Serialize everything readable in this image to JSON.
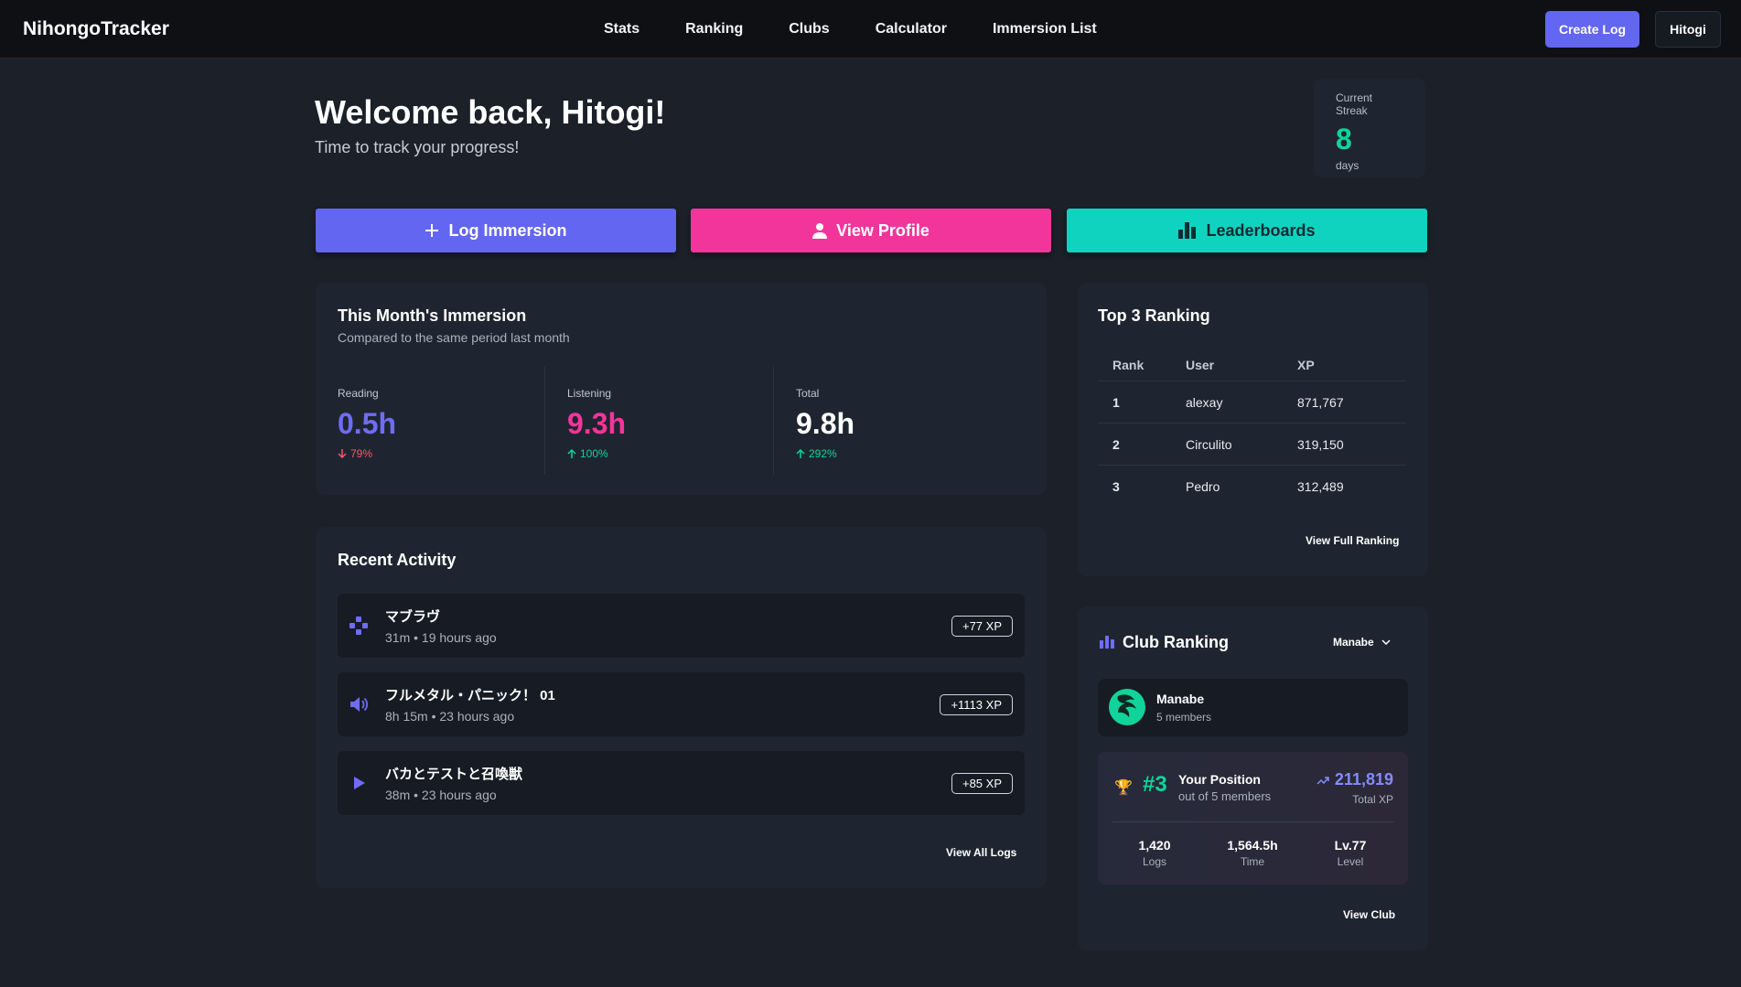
{
  "app": {
    "brand": "NihongoTracker"
  },
  "nav": {
    "items": [
      "Stats",
      "Ranking",
      "Clubs",
      "Calculator",
      "Immersion List"
    ]
  },
  "header": {
    "create_log": "Create Log",
    "user": "Hitogi"
  },
  "hero": {
    "title": "Welcome back, Hitogi!",
    "subtitle": "Time to track your progress!"
  },
  "streak": {
    "label": "Current Streak",
    "value": "8",
    "unit": "days"
  },
  "actions": {
    "log": "Log Immersion",
    "profile": "View Profile",
    "leaderboards": "Leaderboards"
  },
  "month": {
    "title": "This Month's Immersion",
    "subtitle": "Compared to the same period last month",
    "stats": [
      {
        "label": "Reading",
        "value": "0.5h",
        "change": "79%",
        "direction": "down"
      },
      {
        "label": "Listening",
        "value": "9.3h",
        "change": "100%",
        "direction": "up"
      },
      {
        "label": "Total",
        "value": "9.8h",
        "change": "292%",
        "direction": "up"
      }
    ]
  },
  "recent": {
    "title": "Recent Activity",
    "items": [
      {
        "icon": "gamepad-icon",
        "title": "マブラヴ",
        "meta": "31m • 19 hours ago",
        "xp": "+77 XP"
      },
      {
        "icon": "speaker-icon",
        "title": "フルメタル・パニック！ 01",
        "meta": "8h 15m • 23 hours ago",
        "xp": "+1113 XP"
      },
      {
        "icon": "play-icon",
        "title": "バカとテストと召喚獣",
        "meta": "38m • 23 hours ago",
        "xp": "+85 XP"
      }
    ],
    "view_all": "View All Logs"
  },
  "top3": {
    "title": "Top 3 Ranking",
    "headers": [
      "Rank",
      "User",
      "XP"
    ],
    "rows": [
      {
        "rank": "1",
        "user": "alexay",
        "xp": "871,767"
      },
      {
        "rank": "2",
        "user": "Circulito",
        "xp": "319,150"
      },
      {
        "rank": "3",
        "user": "Pedro",
        "xp": "312,489"
      }
    ],
    "view_full": "View Full Ranking"
  },
  "club": {
    "title": "Club Ranking",
    "selected": "Manabe",
    "name": "Manabe",
    "members": "5 members",
    "position": {
      "rank": "#3",
      "label": "Your Position",
      "of": "out of 5 members",
      "total": "211,819",
      "total_label": "Total XP",
      "stats": [
        {
          "value": "1,420",
          "label": "Logs"
        },
        {
          "value": "1,564.5h",
          "label": "Time"
        },
        {
          "value": "Lv.77",
          "label": "Level"
        }
      ]
    },
    "view_club": "View Club"
  },
  "colors": {
    "accent": "#6366f1",
    "pink": "#f2359b",
    "teal": "#10d3bf",
    "green": "#10d49a",
    "reading": "#6f6cf5",
    "listening": "#f2359b",
    "down": "#f05a6b",
    "up": "#10d49a"
  }
}
